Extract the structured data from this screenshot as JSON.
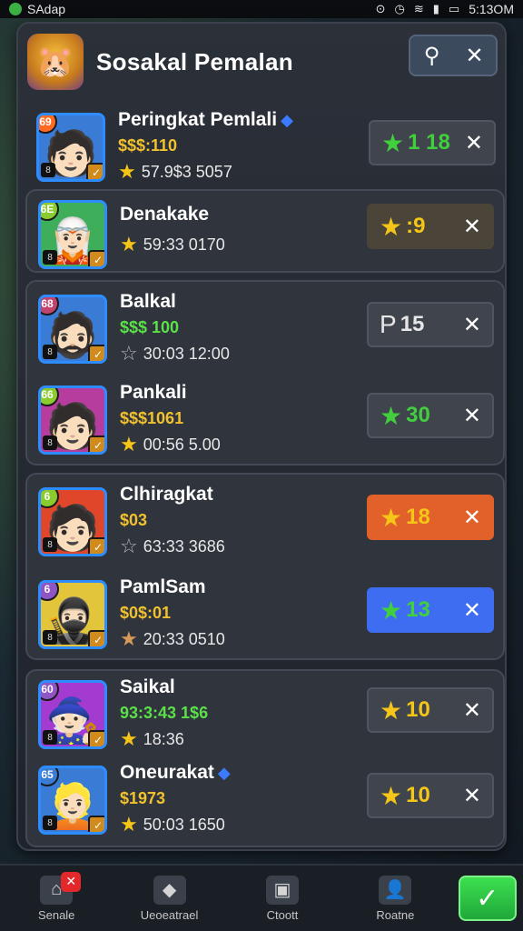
{
  "status_bar": {
    "app": "SAdap",
    "time": "5:13OM"
  },
  "header": {
    "title": "Sosakal Pemalan",
    "avatar_icon": "🐹"
  },
  "players": [
    {
      "name": "Peringkat Pemlali",
      "verified": true,
      "sub": "$$$:110",
      "sub_color": "#f2c12e",
      "meta_star": "★",
      "meta_star_color": "#f5c518",
      "meta": "57.9$3 5057",
      "chip_star": "★",
      "chip_star_color": "#41cf3e",
      "chip_value": "1 18",
      "chip_value_color": "#41cf3e",
      "chip_bg": "#40454d",
      "avatar_bg": "#3a7bd5",
      "avatar_emoji": "🧑🏻",
      "badge_tl": "69",
      "badge_tl_bg": "#ff6b22"
    },
    {
      "name": "Denakake",
      "verified": false,
      "sub": "",
      "sub_color": "#f2c12e",
      "meta_star": "★",
      "meta_star_color": "#f5c518",
      "meta": "59:33 0170",
      "chip_star": "★",
      "chip_star_color": "#f5c518",
      "chip_value": ":9",
      "chip_value_color": "#f5c518",
      "chip_bg": "#4a4538",
      "avatar_bg": "#3fae5a",
      "avatar_emoji": "🧝🏻",
      "badge_tl": "6E",
      "badge_tl_bg": "#8acb2d"
    },
    {
      "name": "Balkal",
      "verified": false,
      "sub": "$$$ 100",
      "sub_color": "#5ce04a",
      "meta_star": "☆",
      "meta_star_color": "#b8b8b8",
      "meta": "30:03 12:00",
      "chip_star": "P",
      "chip_star_color": "#e6e6e6",
      "chip_value": "15",
      "chip_value_color": "#e6e6e6",
      "chip_bg": "#40454d",
      "avatar_bg": "#3a7bd5",
      "avatar_emoji": "🧔🏻",
      "badge_tl": "68",
      "badge_tl_bg": "#c2436d"
    },
    {
      "name": "Pankali",
      "verified": false,
      "sub": "$$$1061",
      "sub_color": "#f2c12e",
      "meta_star": "★",
      "meta_star_color": "#f5c518",
      "meta": "00:56 5.00",
      "chip_star": "★",
      "chip_star_color": "#41cf3e",
      "chip_value": "30",
      "chip_value_color": "#41cf3e",
      "chip_bg": "#40454d",
      "avatar_bg": "#b63c9d",
      "avatar_emoji": "🧑🏻",
      "badge_tl": "66",
      "badge_tl_bg": "#8acb2d"
    },
    {
      "name": "Clhiragkat",
      "verified": false,
      "sub": "$03",
      "sub_color": "#f2c12e",
      "meta_star": "☆",
      "meta_star_color": "#b8b8b8",
      "meta": "63:33 3686",
      "chip_star": "★",
      "chip_star_color": "#f5c518",
      "chip_value": "18",
      "chip_value_color": "#f5c518",
      "chip_bg": "#e2602a",
      "avatar_bg": "#e0462a",
      "avatar_emoji": "🧑🏻",
      "badge_tl": "6",
      "badge_tl_bg": "#8acb2d"
    },
    {
      "name": "PamlSam",
      "verified": false,
      "sub": "$0$:01",
      "sub_color": "#f2c12e",
      "meta_star": "★",
      "meta_star_color": "#d89a5a",
      "meta": "20:33 0510",
      "chip_star": "★",
      "chip_star_color": "#41cf3e",
      "chip_value": "13",
      "chip_value_color": "#41cf3e",
      "chip_bg": "#3f6df2",
      "avatar_bg": "#e2c53a",
      "avatar_emoji": "🥷🏻",
      "badge_tl": "6",
      "badge_tl_bg": "#8f55c4"
    },
    {
      "name": "Saikal",
      "verified": false,
      "sub": "93:3:43 1$6",
      "sub_color": "#5ce04a",
      "meta_star": "★",
      "meta_star_color": "#f5c518",
      "meta": "18:36",
      "chip_star": "★",
      "chip_star_color": "#f5c518",
      "chip_value": "10",
      "chip_value_color": "#f5c518",
      "chip_bg": "#40454d",
      "avatar_bg": "#a33bd1",
      "avatar_emoji": "🧙🏻",
      "badge_tl": "60",
      "badge_tl_bg": "#8f55c4"
    },
    {
      "name": "Oneurakat",
      "verified": true,
      "sub": "$1973",
      "sub_color": "#f2c12e",
      "meta_star": "★",
      "meta_star_color": "#f5c518",
      "meta": "50:03 1650",
      "chip_star": "★",
      "chip_star_color": "#f5c518",
      "chip_value": "10",
      "chip_value_color": "#f5c518",
      "chip_bg": "#40454d",
      "avatar_bg": "#3a7bd5",
      "avatar_emoji": "👱🏻",
      "badge_tl": "65",
      "badge_tl_bg": "#3a7bd5"
    }
  ],
  "bottom_nav": [
    {
      "label": "Senale",
      "icon": "⌂",
      "badge": "✕"
    },
    {
      "label": "Ueoeatrael",
      "icon": "◆"
    },
    {
      "label": "Ctoott",
      "icon": "▣"
    },
    {
      "label": "Roatne",
      "icon": "👤"
    }
  ],
  "confirm_icon": "✓"
}
